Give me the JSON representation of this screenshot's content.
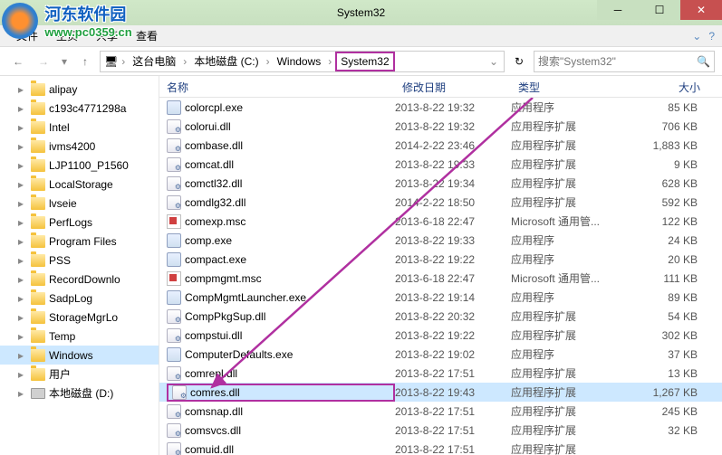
{
  "window": {
    "title": "System32"
  },
  "menu": {
    "file": "文件",
    "home": "主页",
    "share": "共享",
    "view": "查看"
  },
  "breadcrumb": {
    "segs": [
      "这台电脑",
      "本地磁盘 (C:)",
      "Windows",
      "System32"
    ]
  },
  "search": {
    "placeholder": "搜索\"System32\""
  },
  "sidebar": {
    "items": [
      {
        "label": "alipay",
        "type": "folder"
      },
      {
        "label": "c193c4771298a",
        "type": "folder"
      },
      {
        "label": "Intel",
        "type": "folder"
      },
      {
        "label": "ivms4200",
        "type": "folder"
      },
      {
        "label": "LJP1100_P1560",
        "type": "folder"
      },
      {
        "label": "LocalStorage",
        "type": "folder"
      },
      {
        "label": "lvseie",
        "type": "folder"
      },
      {
        "label": "PerfLogs",
        "type": "folder"
      },
      {
        "label": "Program Files",
        "type": "folder"
      },
      {
        "label": "PSS",
        "type": "folder"
      },
      {
        "label": "RecordDownlo",
        "type": "folder"
      },
      {
        "label": "SadpLog",
        "type": "folder"
      },
      {
        "label": "StorageMgrLo",
        "type": "folder"
      },
      {
        "label": "Temp",
        "type": "folder"
      },
      {
        "label": "Windows",
        "type": "folder",
        "selected": true
      },
      {
        "label": "用户",
        "type": "folder"
      },
      {
        "label": "本地磁盘 (D:)",
        "type": "drive"
      }
    ]
  },
  "columns": {
    "name": "名称",
    "date": "修改日期",
    "type": "类型",
    "size": "大小"
  },
  "files": [
    {
      "name": "colorcpl.exe",
      "date": "2013-8-22 19:32",
      "type": "应用程序",
      "size": "85 KB",
      "ico": "exe"
    },
    {
      "name": "colorui.dll",
      "date": "2013-8-22 19:32",
      "type": "应用程序扩展",
      "size": "706 KB",
      "ico": "dll"
    },
    {
      "name": "combase.dll",
      "date": "2014-2-22 23:46",
      "type": "应用程序扩展",
      "size": "1,883 KB",
      "ico": "dll"
    },
    {
      "name": "comcat.dll",
      "date": "2013-8-22 19:33",
      "type": "应用程序扩展",
      "size": "9 KB",
      "ico": "dll"
    },
    {
      "name": "comctl32.dll",
      "date": "2013-8-22 19:34",
      "type": "应用程序扩展",
      "size": "628 KB",
      "ico": "dll"
    },
    {
      "name": "comdlg32.dll",
      "date": "2014-2-22 18:50",
      "type": "应用程序扩展",
      "size": "592 KB",
      "ico": "dll"
    },
    {
      "name": "comexp.msc",
      "date": "2013-6-18 22:47",
      "type": "Microsoft 通用管...",
      "size": "122 KB",
      "ico": "msc"
    },
    {
      "name": "comp.exe",
      "date": "2013-8-22 19:33",
      "type": "应用程序",
      "size": "24 KB",
      "ico": "exe"
    },
    {
      "name": "compact.exe",
      "date": "2013-8-22 19:22",
      "type": "应用程序",
      "size": "20 KB",
      "ico": "exe"
    },
    {
      "name": "compmgmt.msc",
      "date": "2013-6-18 22:47",
      "type": "Microsoft 通用管...",
      "size": "111 KB",
      "ico": "msc"
    },
    {
      "name": "CompMgmtLauncher.exe",
      "date": "2013-8-22 19:14",
      "type": "应用程序",
      "size": "89 KB",
      "ico": "exe"
    },
    {
      "name": "CompPkgSup.dll",
      "date": "2013-8-22 20:32",
      "type": "应用程序扩展",
      "size": "54 KB",
      "ico": "dll"
    },
    {
      "name": "compstui.dll",
      "date": "2013-8-22 19:22",
      "type": "应用程序扩展",
      "size": "302 KB",
      "ico": "dll"
    },
    {
      "name": "ComputerDefaults.exe",
      "date": "2013-8-22 19:02",
      "type": "应用程序",
      "size": "37 KB",
      "ico": "exe"
    },
    {
      "name": "comrepl.dll",
      "date": "2013-8-22 17:51",
      "type": "应用程序扩展",
      "size": "13 KB",
      "ico": "dll"
    },
    {
      "name": "comres.dll",
      "date": "2013-8-22 19:43",
      "type": "应用程序扩展",
      "size": "1,267 KB",
      "ico": "dll",
      "sel": true,
      "hl": true
    },
    {
      "name": "comsnap.dll",
      "date": "2013-8-22 17:51",
      "type": "应用程序扩展",
      "size": "245 KB",
      "ico": "dll"
    },
    {
      "name": "comsvcs.dll",
      "date": "2013-8-22 17:51",
      "type": "应用程序扩展",
      "size": "32 KB",
      "ico": "dll"
    },
    {
      "name": "comuid.dll",
      "date": "2013-8-22 17:51",
      "type": "应用程序扩展",
      "size": "",
      "ico": "dll"
    }
  ],
  "watermark": {
    "cn": "河东软件园",
    "url": "www.pc0359.cn"
  }
}
